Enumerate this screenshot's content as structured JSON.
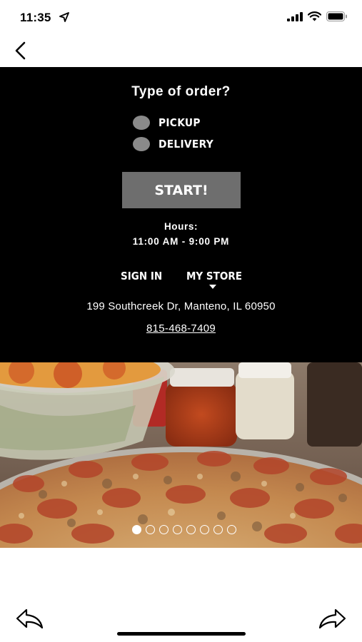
{
  "status_bar": {
    "time": "11:35"
  },
  "order": {
    "title": "Type of order?",
    "options": [
      {
        "label": "PICKUP",
        "selected": false
      },
      {
        "label": "DELIVERY",
        "selected": false
      }
    ],
    "start_label": "START!",
    "hours_label": "Hours:",
    "hours_value": "11:00 AM - 9:00 PM",
    "sign_in_label": "SIGN IN",
    "my_store_label": "MY STORE",
    "address": "199 Southcreek Dr, Manteno, IL 60950",
    "phone": "815-468-7409"
  },
  "carousel": {
    "slide_count": 8,
    "active_index": 0
  },
  "colors": {
    "panel_bg": "#000000",
    "button_bg": "#6e6e6e",
    "radio": "#8a8a8a"
  }
}
